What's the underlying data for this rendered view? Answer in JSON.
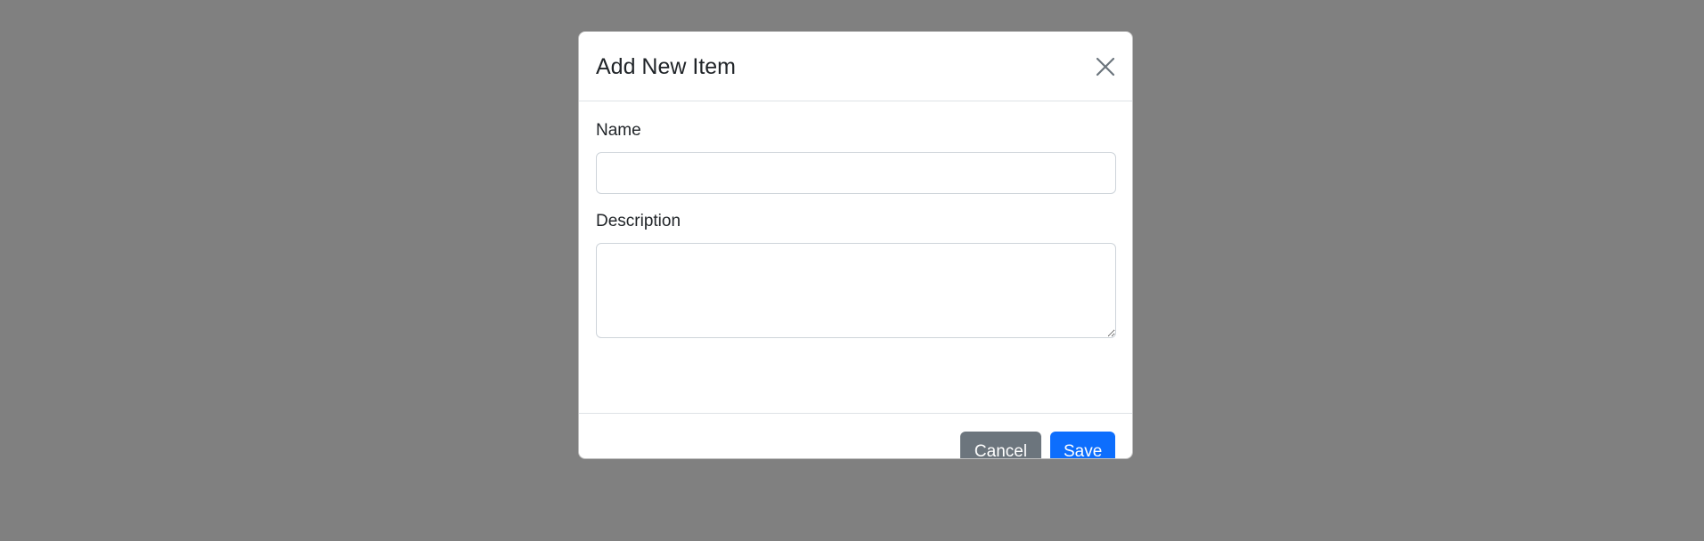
{
  "modal": {
    "title": "Add New Item",
    "close_icon": "close-icon",
    "fields": {
      "name": {
        "label": "Name",
        "value": "",
        "placeholder": ""
      },
      "description": {
        "label": "Description",
        "value": "",
        "placeholder": ""
      }
    },
    "buttons": {
      "cancel_label": "Cancel",
      "save_label": "Save"
    }
  },
  "colors": {
    "backdrop": "#808080",
    "primary": "#0d6efd",
    "secondary": "#6c757d",
    "text": "#212529",
    "border": "#dee2e6"
  }
}
